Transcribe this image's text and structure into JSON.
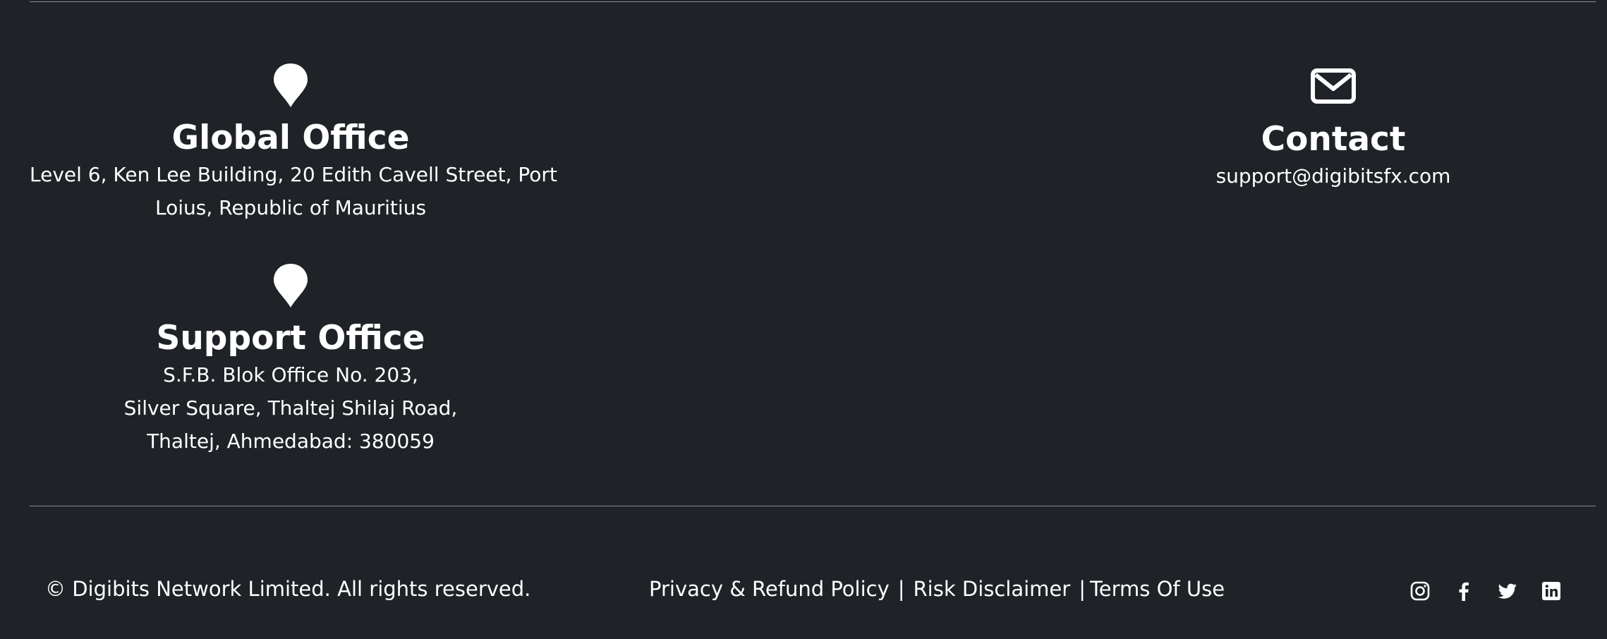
{
  "offices": {
    "global": {
      "icon": "map-marker-icon",
      "title": "Global Office",
      "address_lines": [
        "Level 6, Ken Lee Building, 20 Edith Cavell Street, Port",
        "Loius, Republic of Mauritius"
      ]
    },
    "support": {
      "icon": "map-marker-icon",
      "title": "Support Office",
      "address_lines": [
        "S.F.B. Blok Office No. 203,",
        "Silver Square, Thaltej Shilaj Road,",
        "Thaltej, Ahmedabad: 380059"
      ]
    }
  },
  "contact": {
    "icon": "envelope-icon",
    "title": "Contact",
    "email": "support@digibitsfx.com"
  },
  "footer": {
    "copyright": "© Digibits Network Limited. All rights reserved.",
    "links": {
      "privacy": "Privacy & Refund Policy",
      "risk": "Risk Disclaimer",
      "terms": "Terms Of Use",
      "separator": "|"
    },
    "social": [
      "instagram-icon",
      "facebook-icon",
      "twitter-icon",
      "linkedin-icon"
    ]
  },
  "colors": {
    "background": "#1f2226",
    "text": "#ffffff",
    "divider": "#8b8f94"
  }
}
